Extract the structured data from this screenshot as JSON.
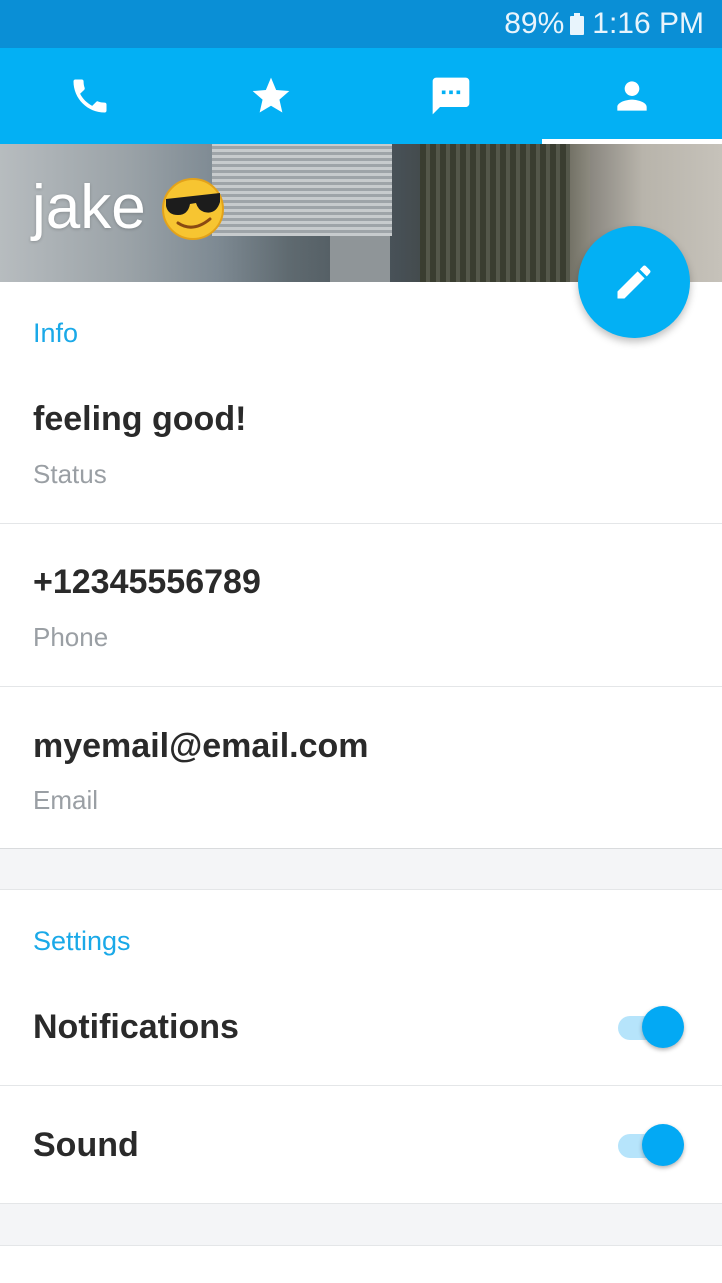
{
  "status_bar": {
    "battery": "89%",
    "time": "1:16 PM"
  },
  "tabs": [
    {
      "icon": "phone-icon",
      "active": false
    },
    {
      "icon": "star-icon",
      "active": false
    },
    {
      "icon": "chat-icon",
      "active": false
    },
    {
      "icon": "person-icon",
      "active": true
    }
  ],
  "profile": {
    "name": "jake",
    "emoji": "sunglasses-wink-emoji"
  },
  "info": {
    "title": "Info",
    "rows": [
      {
        "value": "feeling good!",
        "label": "Status"
      },
      {
        "value": "+12345556789",
        "label": "Phone"
      },
      {
        "value": "myemail@email.com",
        "label": "Email"
      }
    ]
  },
  "settings": {
    "title": "Settings",
    "rows": [
      {
        "label": "Notifications",
        "enabled": true
      },
      {
        "label": "Sound",
        "enabled": true
      }
    ]
  },
  "colors": {
    "primary": "#03b0f4",
    "status_bar": "#0a8fd6",
    "section_title": "#1aa9e8"
  }
}
